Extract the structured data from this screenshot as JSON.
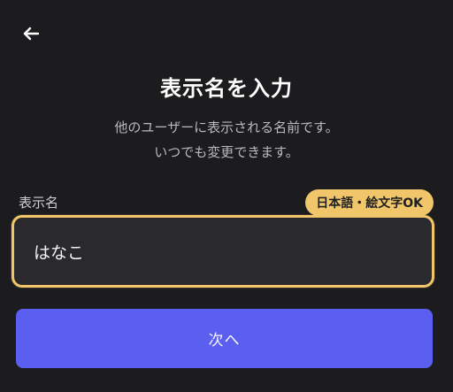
{
  "header": {
    "back_icon": "arrow-left-icon",
    "title": "表示名を入力"
  },
  "description": {
    "line1": "他のユーザーに表示される名前です。",
    "line2": "いつでも変更できます。"
  },
  "form": {
    "label": "表示名",
    "badge": "日本語・絵文字OK",
    "value": "はなこ"
  },
  "actions": {
    "next_label": "次へ"
  },
  "colors": {
    "background": "#1c1c1e",
    "accent_border": "#f1c66b",
    "badge_background": "#f1c66b",
    "input_background": "#2a2a2e",
    "button_background": "#5b5ff0"
  }
}
